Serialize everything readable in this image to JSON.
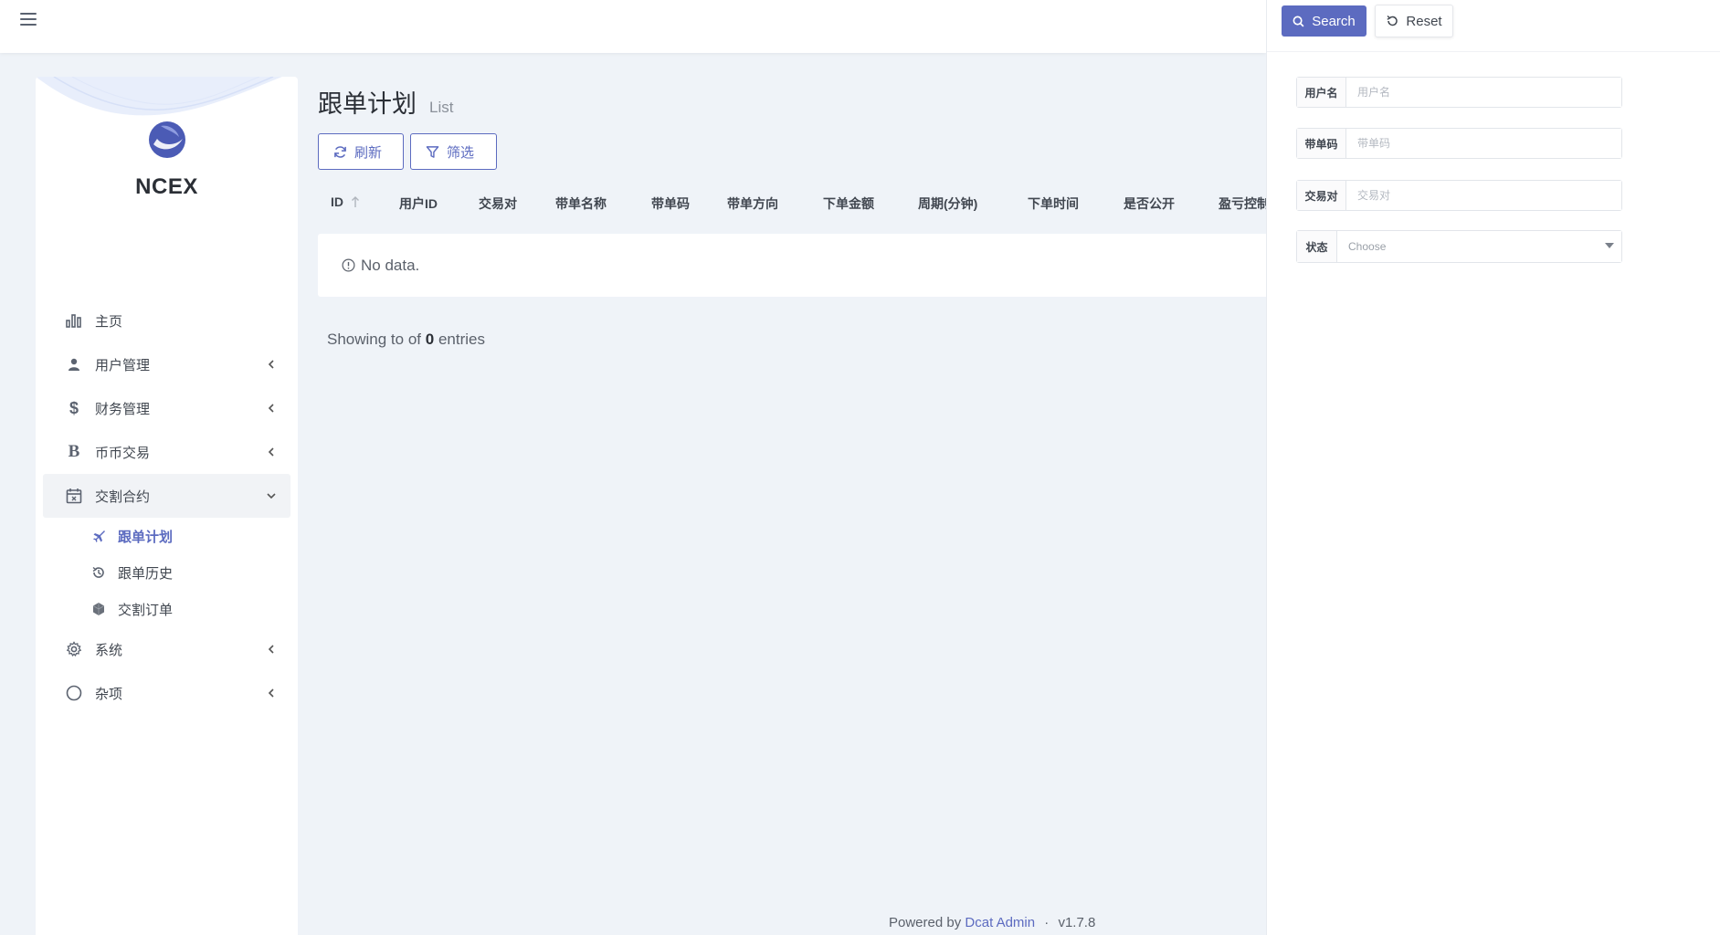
{
  "brand": {
    "name": "NCEX"
  },
  "menu": {
    "items": [
      {
        "label": "主页",
        "icon": "bar-chart-icon"
      },
      {
        "label": "用户管理",
        "icon": "users-icon"
      },
      {
        "label": "财务管理",
        "icon": "dollar-icon"
      },
      {
        "label": "币币交易",
        "icon": "bitcoin-icon"
      },
      {
        "label": "交割合约",
        "icon": "calendar-icon"
      },
      {
        "label": "系统",
        "icon": "gear-icon"
      },
      {
        "label": "杂项",
        "icon": "circle-icon"
      }
    ],
    "submenu": [
      {
        "label": "跟单计划",
        "icon": "plane-icon"
      },
      {
        "label": "跟单历史",
        "icon": "history-icon"
      },
      {
        "label": "交割订单",
        "icon": "hexagon-icon"
      }
    ]
  },
  "page": {
    "title": "跟单计划",
    "subtitle": "List",
    "refresh_label": "刷新",
    "filter_label": "筛选"
  },
  "table": {
    "columns": [
      "ID",
      "用户ID",
      "交易对",
      "带单名称",
      "带单码",
      "带单方向",
      "下单金额",
      "周期(分钟)",
      "下单时间",
      "是否公开",
      "盈亏控制"
    ],
    "empty_text": "No data.",
    "entries_prefix": "Showing to of",
    "entries_count": "0",
    "entries_suffix": "entries"
  },
  "footer": {
    "prefix": "Powered by",
    "link": "Dcat Admin",
    "separator": "·",
    "version": "v1.7.8"
  },
  "filter": {
    "search_label": "Search",
    "reset_label": "Reset",
    "fields": [
      {
        "label": "用户名",
        "placeholder": "用户名"
      },
      {
        "label": "带单码",
        "placeholder": "带单码"
      },
      {
        "label": "交易对",
        "placeholder": "交易对"
      }
    ],
    "status": {
      "label": "状态",
      "value": "Choose"
    }
  },
  "colors": {
    "primary": "#5c6bc0",
    "background": "#eff3f8"
  }
}
